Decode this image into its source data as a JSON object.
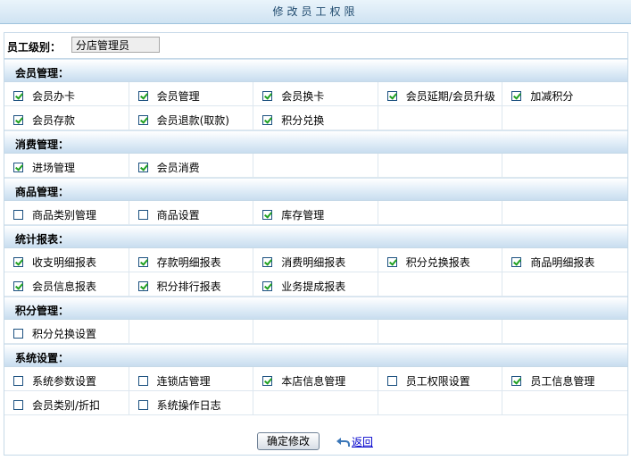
{
  "title": "修改员工权限",
  "level": {
    "label": "员工级别：",
    "value": "分店管理员"
  },
  "sections": [
    {
      "name": "会员管理：",
      "rows": [
        [
          {
            "label": "会员办卡",
            "checked": true
          },
          {
            "label": "会员管理",
            "checked": true
          },
          {
            "label": "会员换卡",
            "checked": true
          },
          {
            "label": "会员延期/会员升级",
            "checked": true
          },
          {
            "label": "加减积分",
            "checked": true
          }
        ],
        [
          {
            "label": "会员存款",
            "checked": true
          },
          {
            "label": "会员退款(取款)",
            "checked": true
          },
          {
            "label": "积分兑换",
            "checked": true
          },
          null,
          null
        ]
      ]
    },
    {
      "name": "消费管理：",
      "rows": [
        [
          {
            "label": "进场管理",
            "checked": true
          },
          {
            "label": "会员消费",
            "checked": true
          },
          null,
          null,
          null
        ]
      ]
    },
    {
      "name": "商品管理：",
      "rows": [
        [
          {
            "label": "商品类别管理",
            "checked": false
          },
          {
            "label": "商品设置",
            "checked": false
          },
          {
            "label": "库存管理",
            "checked": true
          },
          null,
          null
        ]
      ]
    },
    {
      "name": "统计报表：",
      "rows": [
        [
          {
            "label": "收支明细报表",
            "checked": true
          },
          {
            "label": "存款明细报表",
            "checked": true
          },
          {
            "label": "消费明细报表",
            "checked": true
          },
          {
            "label": "积分兑换报表",
            "checked": true
          },
          {
            "label": "商品明细报表",
            "checked": true
          }
        ],
        [
          {
            "label": "会员信息报表",
            "checked": true
          },
          {
            "label": "积分排行报表",
            "checked": true
          },
          {
            "label": "业务提成报表",
            "checked": true
          },
          null,
          null
        ]
      ]
    },
    {
      "name": "积分管理：",
      "rows": [
        [
          {
            "label": "积分兑换设置",
            "checked": false
          },
          null,
          null,
          null,
          null
        ]
      ]
    },
    {
      "name": "系统设置：",
      "rows": [
        [
          {
            "label": "系统参数设置",
            "checked": false
          },
          {
            "label": "连锁店管理",
            "checked": false
          },
          {
            "label": "本店信息管理",
            "checked": true
          },
          {
            "label": "员工权限设置",
            "checked": false
          },
          {
            "label": "员工信息管理",
            "checked": true
          }
        ],
        [
          {
            "label": "会员类别/折扣",
            "checked": false
          },
          {
            "label": "系统操作日志",
            "checked": false
          },
          null,
          null,
          null
        ]
      ]
    }
  ],
  "submit_label": "确定修改",
  "back_label": "返回",
  "colors": {
    "section_bg": "#c8ddef",
    "check": "#21a121",
    "link": "#0000cc"
  }
}
